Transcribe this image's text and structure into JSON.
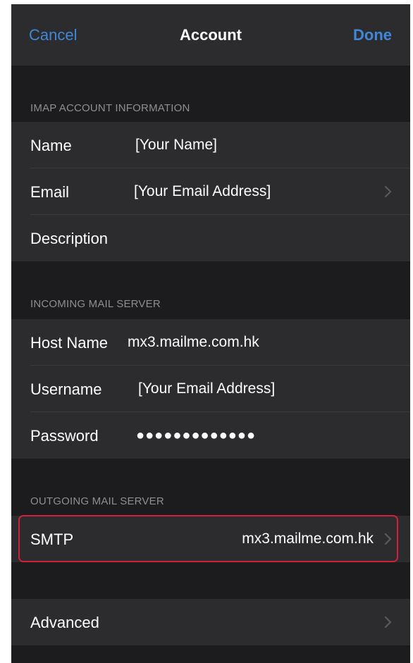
{
  "nav": {
    "cancel_label": "Cancel",
    "title": "Account",
    "done_label": "Done"
  },
  "sections": {
    "imap_header": "IMAP ACCOUNT INFORMATION",
    "incoming_header": "INCOMING MAIL SERVER",
    "outgoing_header": "OUTGOING MAIL SERVER"
  },
  "imap": {
    "name_label": "Name",
    "name_value": "[Your Name]",
    "email_label": "Email",
    "email_value": "[Your Email Address]",
    "description_label": "Description",
    "description_value": ""
  },
  "incoming": {
    "host_label": "Host Name",
    "host_value": "mx3.mailme.com.hk",
    "username_label": "Username",
    "username_value": "[Your Email Address]",
    "password_label": "Password",
    "password_value": "●●●●●●●●●●●●●"
  },
  "outgoing": {
    "smtp_label": "SMTP",
    "smtp_value": "mx3.mailme.com.hk"
  },
  "advanced": {
    "label": "Advanced"
  },
  "colors": {
    "background": "#1c1c1e",
    "cell": "#2c2c2e",
    "accent": "#3f87d9",
    "highlight": "#d1213a"
  },
  "icons": {
    "chevron": "chevron-right-icon"
  }
}
